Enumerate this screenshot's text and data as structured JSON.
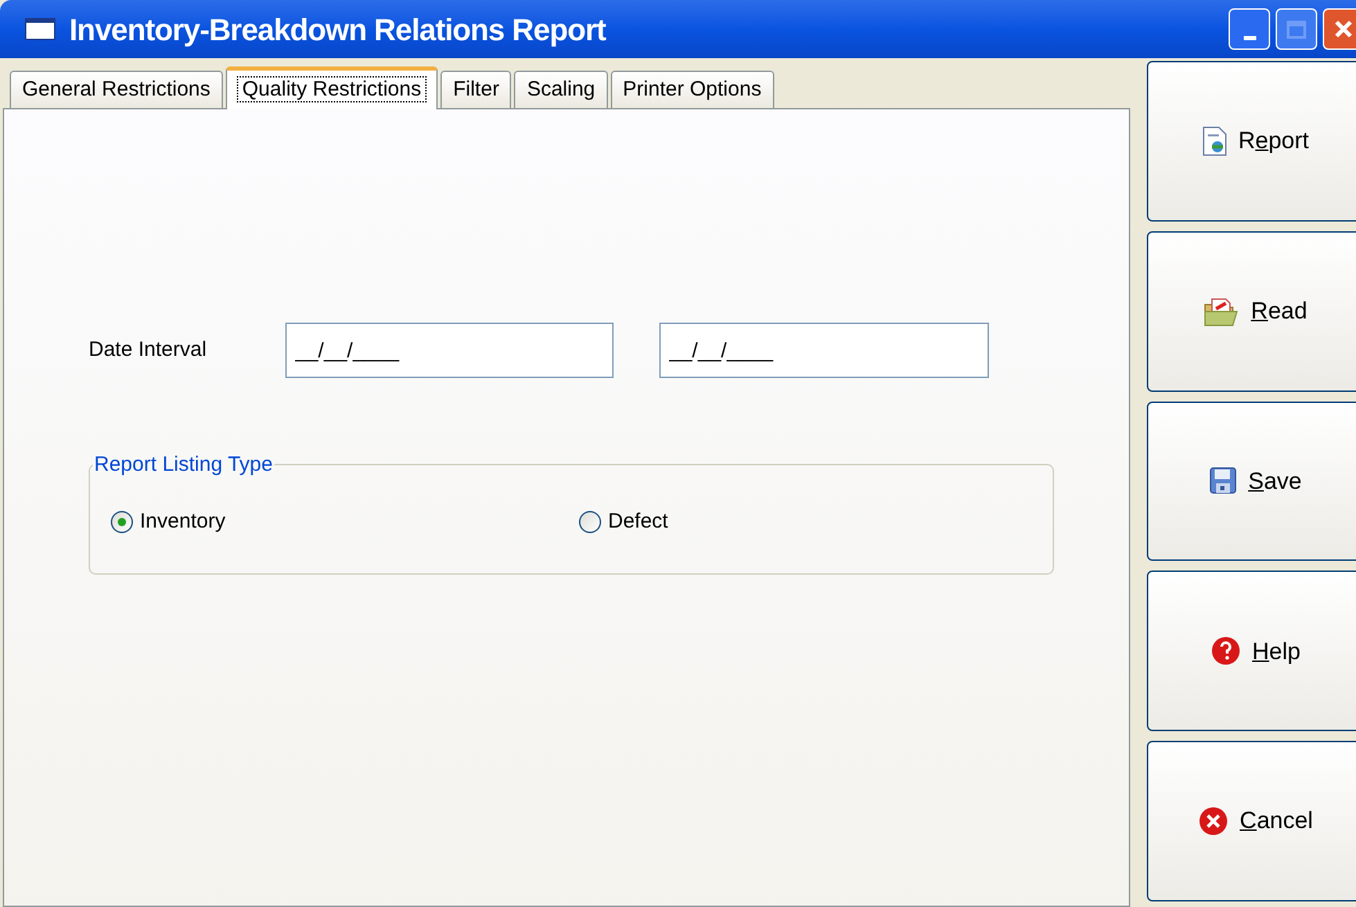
{
  "window": {
    "title": "Inventory-Breakdown Relations Report"
  },
  "tabs": [
    {
      "label": "General Restrictions",
      "selected": false
    },
    {
      "label": "Quality Restrictions",
      "selected": true
    },
    {
      "label": "Filter",
      "selected": false
    },
    {
      "label": "Scaling",
      "selected": false
    },
    {
      "label": "Printer Options",
      "selected": false
    }
  ],
  "date_interval": {
    "label": "Date Interval",
    "from": "__/__/____",
    "to": "__/__/____"
  },
  "report_listing_type": {
    "title": "Report Listing Type",
    "options": [
      {
        "label": "Inventory",
        "selected": true
      },
      {
        "label": "Defect",
        "selected": false
      }
    ]
  },
  "buttons": [
    {
      "kind": "report",
      "pre": "R",
      "key": "e",
      "post": "port"
    },
    {
      "kind": "read",
      "key": "R",
      "post": "ead"
    },
    {
      "kind": "save",
      "key": "S",
      "post": "ave"
    },
    {
      "kind": "help",
      "key": "H",
      "post": "elp"
    },
    {
      "kind": "cancel",
      "key": "C",
      "post": "ancel"
    }
  ]
}
